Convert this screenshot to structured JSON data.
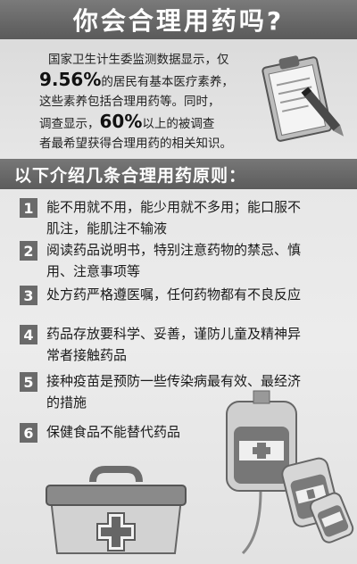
{
  "title": "你会合理用药吗?",
  "intro": {
    "l1": "国家卫生计生委监测数据显示，仅",
    "pct1": "9.56%",
    "l2": "的居民有基本医疗素养，",
    "l3": "这些素养包括合理用药等。同时，",
    "l4a": "调查显示，",
    "pct2": "60%",
    "l4b": "以上的被调查",
    "l5": "者最希望获得合理用药的相关知识。"
  },
  "section_title": "以下介绍几条合理用药原则：",
  "principles": [
    {
      "num": "1",
      "l1": "能不用就不用，能少用就不多用；能口服不",
      "l2": "肌注，能肌注不输液"
    },
    {
      "num": "2",
      "l1": "阅读药品说明书，特别注意药物的禁忌、慎",
      "l2": "用、注意事项等"
    },
    {
      "num": "3",
      "l1": "处方药严格遵医嘱，任何药物都有不良反应",
      "l2": ""
    },
    {
      "num": "4",
      "l1": "药品存放要科学、妥善，谨防儿童及精神异",
      "l2": "常者接触药品"
    },
    {
      "num": "5",
      "l1": "接种疫苗是预防一些传染病最有效、最经济",
      "l2": "的措施"
    },
    {
      "num": "6",
      "l1": "保健食品不能替代药品",
      "l2": ""
    }
  ],
  "colors": {
    "accent": "#5c5c5c",
    "text": "#1a1a1a"
  },
  "icons": [
    "clipboard-pen-icon",
    "medical-kit-icon",
    "iv-bag-icon"
  ]
}
